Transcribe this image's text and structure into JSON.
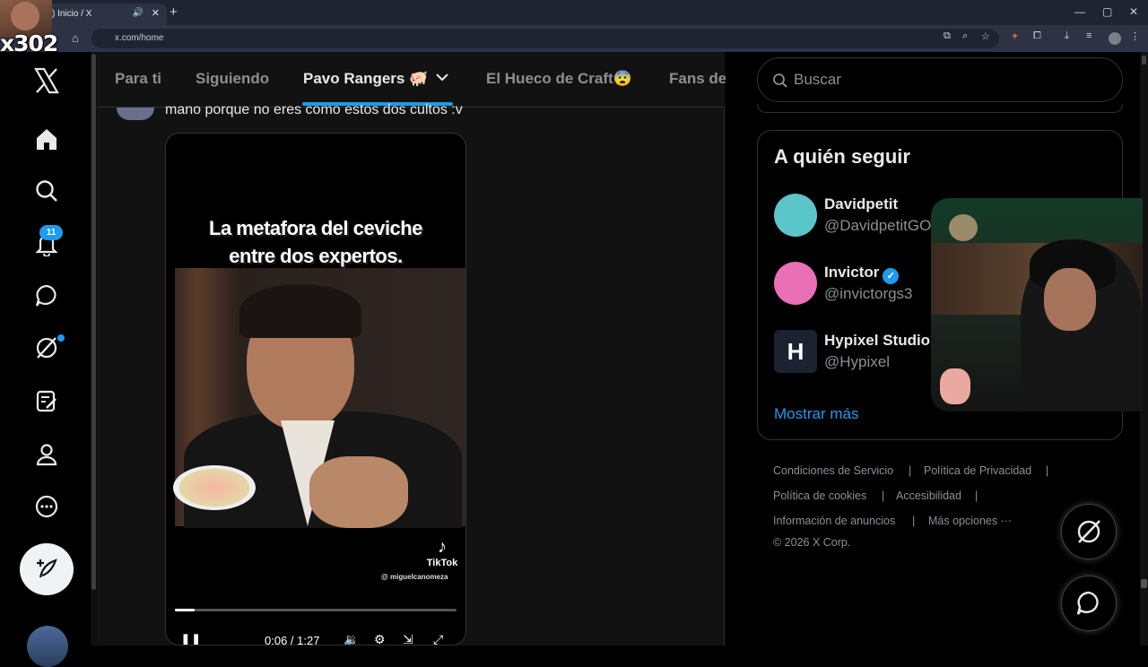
{
  "browser": {
    "tab_title": ") Inicio / X",
    "url": "x.com/home",
    "new_tab": "+",
    "tab_close": "✕",
    "tab_sound": "🔊",
    "window_controls": [
      "—",
      "▢",
      "✕"
    ]
  },
  "overlay": {
    "counter": "x302"
  },
  "sidebar": {
    "notifications_badge": "11",
    "icons": [
      "x-logo-icon",
      "home-icon",
      "search-icon",
      "bell-icon",
      "messages-icon",
      "grok-icon",
      "lists-icon",
      "profile-icon",
      "more-icon",
      "compose-icon"
    ]
  },
  "feed": {
    "tabs": [
      {
        "label": "Para ti"
      },
      {
        "label": "Siguiendo"
      },
      {
        "label": "Pavo Rangers 🐖"
      },
      {
        "label": "El Hueco de Craft😨"
      },
      {
        "label": "Fans de"
      }
    ],
    "active_tab": "Pavo Rangers 🐖",
    "post_text": "mano porque no eres como estos dos cultos :v",
    "video": {
      "caption_line1": "La metafora del ceviche",
      "caption_line2": "entre dos expertos.",
      "watermark": "TikTok",
      "watermark_user": "@ miguelcanomeza",
      "time": "0:06 / 1:27",
      "progress": 0.07
    }
  },
  "right": {
    "search_placeholder": "Buscar",
    "who_to_follow": {
      "title": "A quién seguir",
      "accounts": [
        {
          "name": "Davidpetit",
          "handle": "@DavidpetitGO",
          "verified": false,
          "color": "#5bc6c9"
        },
        {
          "name": "Invictor",
          "handle": "@invictorgs3",
          "verified": true,
          "color": "#e96fb6"
        },
        {
          "name": "Hypixel Studios",
          "handle": "@Hypixel",
          "verified": false,
          "color": "#1c2230"
        }
      ],
      "show_more": "Mostrar más"
    },
    "footer": {
      "links": [
        "Condiciones de Servicio",
        "|",
        "Política de Privacidad",
        "|",
        "Política de cookies",
        "|",
        "Accesibilidad",
        "|",
        "Información de anuncios",
        "|",
        "Más opciones ···"
      ],
      "copyright": "© 2026 X Corp."
    }
  },
  "colors": {
    "accent": "#1d9bf0",
    "background": "#000000",
    "text": "#e7e9ea",
    "muted": "#8b8f94"
  }
}
